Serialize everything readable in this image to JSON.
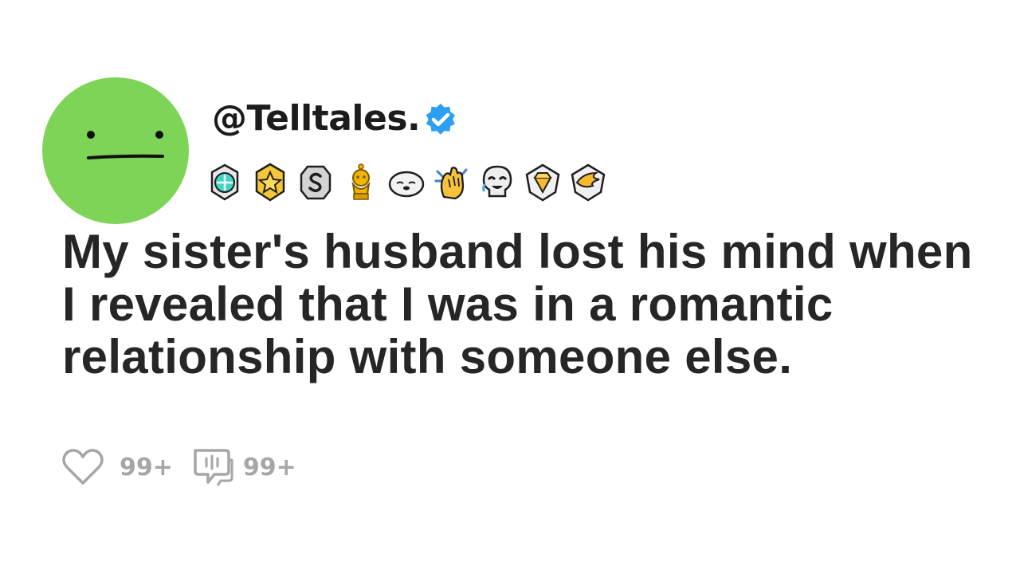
{
  "post": {
    "username": "@Telltales.",
    "verified": true,
    "avatar_color": "#7dd456",
    "title": "My sister's husband lost his mind when I revealed that I was in a romantic relationship with someone else.",
    "likes": "99+",
    "comments": "99+"
  },
  "badges": [
    {
      "name": "helpful-award-icon"
    },
    {
      "name": "star-award-icon"
    },
    {
      "name": "silver-award-icon"
    },
    {
      "name": "snoo-trophy-icon"
    },
    {
      "name": "seal-award-icon"
    },
    {
      "name": "clapping-hands-icon"
    },
    {
      "name": "laughing-skull-icon"
    },
    {
      "name": "gold-diamond-badge-icon"
    },
    {
      "name": "winged-badge-icon"
    }
  ],
  "colors": {
    "verified": "#2d9ff2",
    "stat_gray": "#a6a6a6",
    "text": "#262626"
  }
}
